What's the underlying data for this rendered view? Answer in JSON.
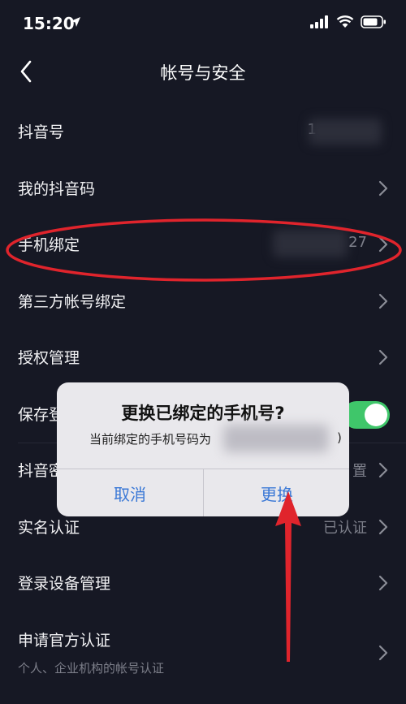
{
  "status_bar": {
    "time": "15:20"
  },
  "nav": {
    "title": "帐号与安全"
  },
  "rows": {
    "douyin_id": {
      "label": "抖音号",
      "value": "1"
    },
    "my_qrcode": {
      "label": "我的抖音码"
    },
    "phone_binding": {
      "label": "手机绑定",
      "value": "27"
    },
    "third_party": {
      "label": "第三方帐号绑定"
    },
    "auth_manage": {
      "label": "授权管理"
    },
    "save_login": {
      "label": "保存登",
      "enabled": true
    },
    "douyin_pwd": {
      "label": "抖音密",
      "value": "置"
    },
    "realname": {
      "label": "实名认证",
      "value": "已认证"
    },
    "device_manage": {
      "label": "登录设备管理"
    },
    "official_cert": {
      "label": "申请官方认证",
      "sub": "个人、企业机构的帐号认证"
    }
  },
  "dialog": {
    "title": "更换已绑定的手机号?",
    "message": "当前绑定的手机号码为",
    "message_end": ")",
    "cancel_label": "取消",
    "change_label": "更换"
  },
  "colors": {
    "background": "#161824",
    "accent_blue": "#3a78d6",
    "toggle_green": "#3fc66a",
    "annotation_red": "#e0242c"
  }
}
